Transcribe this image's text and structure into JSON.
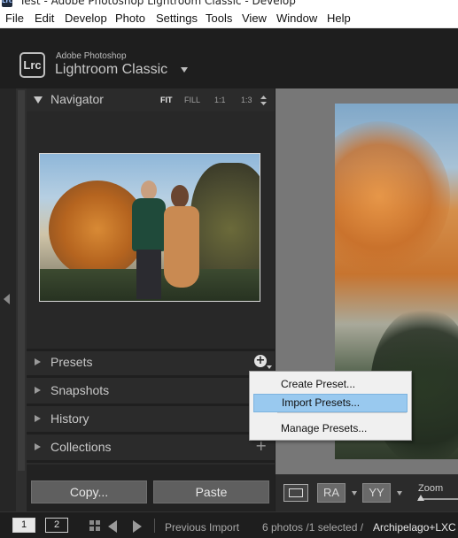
{
  "window": {
    "title": "Test - Adobe Photoshop Lightroom Classic - Develop"
  },
  "menu": [
    "File",
    "Edit",
    "Develop",
    "Photo",
    "Settings",
    "Tools",
    "View",
    "Window",
    "Help"
  ],
  "identity": {
    "logo": "Lrc",
    "small": "Adobe Photoshop",
    "big": "Lightroom Classic"
  },
  "navigator": {
    "title": "Navigator",
    "zoom_options": [
      "FIT",
      "FILL",
      "1:1",
      "1:3"
    ],
    "active_zoom": "FIT"
  },
  "panels": {
    "presets": "Presets",
    "snapshots": "Snapshots",
    "history": "History",
    "collections": "Collections"
  },
  "buttons": {
    "copy": "Copy...",
    "paste": "Paste"
  },
  "context_menu": {
    "items": [
      "Create Preset...",
      "Import Presets...",
      "Manage Presets..."
    ],
    "highlighted": "Import Presets..."
  },
  "toolbar": {
    "before_after_1": "RA",
    "before_after_2": "YY",
    "zoom_label": "Zoom"
  },
  "filmstrip": {
    "monitor_1": "1",
    "monitor_2": "2",
    "source": "Previous Import",
    "count": "6 photos /1 selected /",
    "filename": "Archipelago+LXC"
  },
  "colors": {
    "menu_highlight": "#99c9ef",
    "panel_bg": "#2b2b2b",
    "center_bg": "#777777"
  }
}
